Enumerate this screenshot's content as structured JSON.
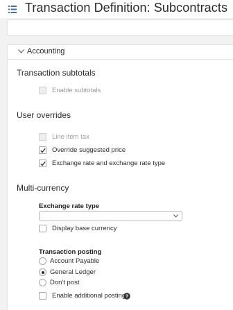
{
  "header": {
    "title": "Transaction Definition: Subcontracts"
  },
  "section": {
    "title": "Accounting"
  },
  "transaction_subtotals": {
    "title": "Transaction subtotals",
    "enable_subtotals": {
      "label": "Enable subtotals",
      "checked": false,
      "disabled": true
    }
  },
  "user_overrides": {
    "title": "User overrides",
    "line_item_tax": {
      "label": "Line item tax",
      "checked": false,
      "disabled": true
    },
    "override_suggested_price": {
      "label": "Override suggested price",
      "checked": true,
      "disabled": false
    },
    "exchange_rate_type": {
      "label": "Exchange rate and exchange rate type",
      "checked": true,
      "disabled": false
    }
  },
  "multi_currency": {
    "title": "Multi-currency",
    "exchange_rate_type_label": "Exchange rate type",
    "exchange_rate_type_value": "",
    "display_base_currency": {
      "label": "Display base currency",
      "checked": false
    }
  },
  "transaction_posting": {
    "label": "Transaction posting",
    "options": [
      "Account Payable",
      "General Ledger",
      "Don't post"
    ],
    "selected": "General Ledger",
    "enable_additional_posting": {
      "label": "Enable additional posting",
      "checked": false
    }
  },
  "colors": {
    "check": "#2a2a2a",
    "accent_icon": "#4a6fa5"
  }
}
